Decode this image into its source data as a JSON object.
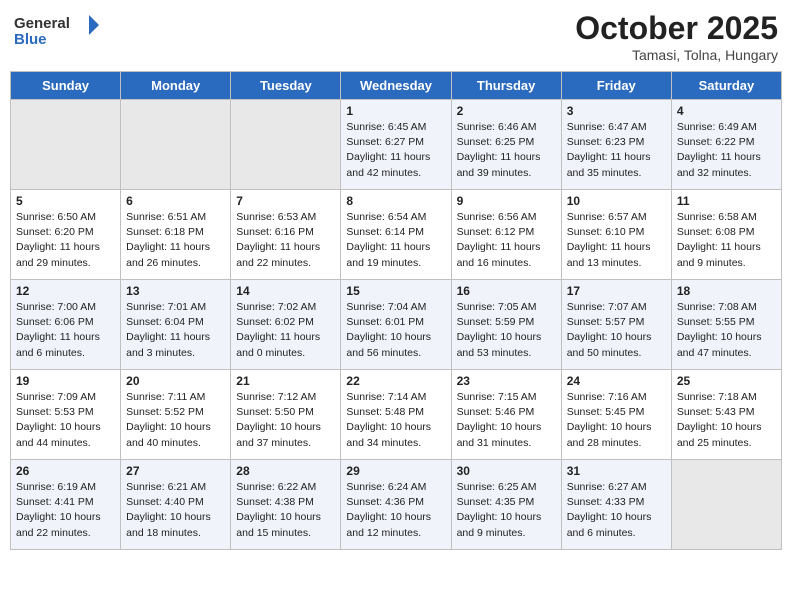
{
  "logo": {
    "text_general": "General",
    "text_blue": "Blue"
  },
  "header": {
    "month_year": "October 2025",
    "location": "Tamasi, Tolna, Hungary"
  },
  "days_of_week": [
    "Sunday",
    "Monday",
    "Tuesday",
    "Wednesday",
    "Thursday",
    "Friday",
    "Saturday"
  ],
  "weeks": [
    [
      {
        "day": "",
        "sunrise": "",
        "sunset": "",
        "daylight": ""
      },
      {
        "day": "",
        "sunrise": "",
        "sunset": "",
        "daylight": ""
      },
      {
        "day": "",
        "sunrise": "",
        "sunset": "",
        "daylight": ""
      },
      {
        "day": "1",
        "sunrise": "Sunrise: 6:45 AM",
        "sunset": "Sunset: 6:27 PM",
        "daylight": "Daylight: 11 hours and 42 minutes."
      },
      {
        "day": "2",
        "sunrise": "Sunrise: 6:46 AM",
        "sunset": "Sunset: 6:25 PM",
        "daylight": "Daylight: 11 hours and 39 minutes."
      },
      {
        "day": "3",
        "sunrise": "Sunrise: 6:47 AM",
        "sunset": "Sunset: 6:23 PM",
        "daylight": "Daylight: 11 hours and 35 minutes."
      },
      {
        "day": "4",
        "sunrise": "Sunrise: 6:49 AM",
        "sunset": "Sunset: 6:22 PM",
        "daylight": "Daylight: 11 hours and 32 minutes."
      }
    ],
    [
      {
        "day": "5",
        "sunrise": "Sunrise: 6:50 AM",
        "sunset": "Sunset: 6:20 PM",
        "daylight": "Daylight: 11 hours and 29 minutes."
      },
      {
        "day": "6",
        "sunrise": "Sunrise: 6:51 AM",
        "sunset": "Sunset: 6:18 PM",
        "daylight": "Daylight: 11 hours and 26 minutes."
      },
      {
        "day": "7",
        "sunrise": "Sunrise: 6:53 AM",
        "sunset": "Sunset: 6:16 PM",
        "daylight": "Daylight: 11 hours and 22 minutes."
      },
      {
        "day": "8",
        "sunrise": "Sunrise: 6:54 AM",
        "sunset": "Sunset: 6:14 PM",
        "daylight": "Daylight: 11 hours and 19 minutes."
      },
      {
        "day": "9",
        "sunrise": "Sunrise: 6:56 AM",
        "sunset": "Sunset: 6:12 PM",
        "daylight": "Daylight: 11 hours and 16 minutes."
      },
      {
        "day": "10",
        "sunrise": "Sunrise: 6:57 AM",
        "sunset": "Sunset: 6:10 PM",
        "daylight": "Daylight: 11 hours and 13 minutes."
      },
      {
        "day": "11",
        "sunrise": "Sunrise: 6:58 AM",
        "sunset": "Sunset: 6:08 PM",
        "daylight": "Daylight: 11 hours and 9 minutes."
      }
    ],
    [
      {
        "day": "12",
        "sunrise": "Sunrise: 7:00 AM",
        "sunset": "Sunset: 6:06 PM",
        "daylight": "Daylight: 11 hours and 6 minutes."
      },
      {
        "day": "13",
        "sunrise": "Sunrise: 7:01 AM",
        "sunset": "Sunset: 6:04 PM",
        "daylight": "Daylight: 11 hours and 3 minutes."
      },
      {
        "day": "14",
        "sunrise": "Sunrise: 7:02 AM",
        "sunset": "Sunset: 6:02 PM",
        "daylight": "Daylight: 11 hours and 0 minutes."
      },
      {
        "day": "15",
        "sunrise": "Sunrise: 7:04 AM",
        "sunset": "Sunset: 6:01 PM",
        "daylight": "Daylight: 10 hours and 56 minutes."
      },
      {
        "day": "16",
        "sunrise": "Sunrise: 7:05 AM",
        "sunset": "Sunset: 5:59 PM",
        "daylight": "Daylight: 10 hours and 53 minutes."
      },
      {
        "day": "17",
        "sunrise": "Sunrise: 7:07 AM",
        "sunset": "Sunset: 5:57 PM",
        "daylight": "Daylight: 10 hours and 50 minutes."
      },
      {
        "day": "18",
        "sunrise": "Sunrise: 7:08 AM",
        "sunset": "Sunset: 5:55 PM",
        "daylight": "Daylight: 10 hours and 47 minutes."
      }
    ],
    [
      {
        "day": "19",
        "sunrise": "Sunrise: 7:09 AM",
        "sunset": "Sunset: 5:53 PM",
        "daylight": "Daylight: 10 hours and 44 minutes."
      },
      {
        "day": "20",
        "sunrise": "Sunrise: 7:11 AM",
        "sunset": "Sunset: 5:52 PM",
        "daylight": "Daylight: 10 hours and 40 minutes."
      },
      {
        "day": "21",
        "sunrise": "Sunrise: 7:12 AM",
        "sunset": "Sunset: 5:50 PM",
        "daylight": "Daylight: 10 hours and 37 minutes."
      },
      {
        "day": "22",
        "sunrise": "Sunrise: 7:14 AM",
        "sunset": "Sunset: 5:48 PM",
        "daylight": "Daylight: 10 hours and 34 minutes."
      },
      {
        "day": "23",
        "sunrise": "Sunrise: 7:15 AM",
        "sunset": "Sunset: 5:46 PM",
        "daylight": "Daylight: 10 hours and 31 minutes."
      },
      {
        "day": "24",
        "sunrise": "Sunrise: 7:16 AM",
        "sunset": "Sunset: 5:45 PM",
        "daylight": "Daylight: 10 hours and 28 minutes."
      },
      {
        "day": "25",
        "sunrise": "Sunrise: 7:18 AM",
        "sunset": "Sunset: 5:43 PM",
        "daylight": "Daylight: 10 hours and 25 minutes."
      }
    ],
    [
      {
        "day": "26",
        "sunrise": "Sunrise: 6:19 AM",
        "sunset": "Sunset: 4:41 PM",
        "daylight": "Daylight: 10 hours and 22 minutes."
      },
      {
        "day": "27",
        "sunrise": "Sunrise: 6:21 AM",
        "sunset": "Sunset: 4:40 PM",
        "daylight": "Daylight: 10 hours and 18 minutes."
      },
      {
        "day": "28",
        "sunrise": "Sunrise: 6:22 AM",
        "sunset": "Sunset: 4:38 PM",
        "daylight": "Daylight: 10 hours and 15 minutes."
      },
      {
        "day": "29",
        "sunrise": "Sunrise: 6:24 AM",
        "sunset": "Sunset: 4:36 PM",
        "daylight": "Daylight: 10 hours and 12 minutes."
      },
      {
        "day": "30",
        "sunrise": "Sunrise: 6:25 AM",
        "sunset": "Sunset: 4:35 PM",
        "daylight": "Daylight: 10 hours and 9 minutes."
      },
      {
        "day": "31",
        "sunrise": "Sunrise: 6:27 AM",
        "sunset": "Sunset: 4:33 PM",
        "daylight": "Daylight: 10 hours and 6 minutes."
      },
      {
        "day": "",
        "sunrise": "",
        "sunset": "",
        "daylight": ""
      }
    ]
  ]
}
